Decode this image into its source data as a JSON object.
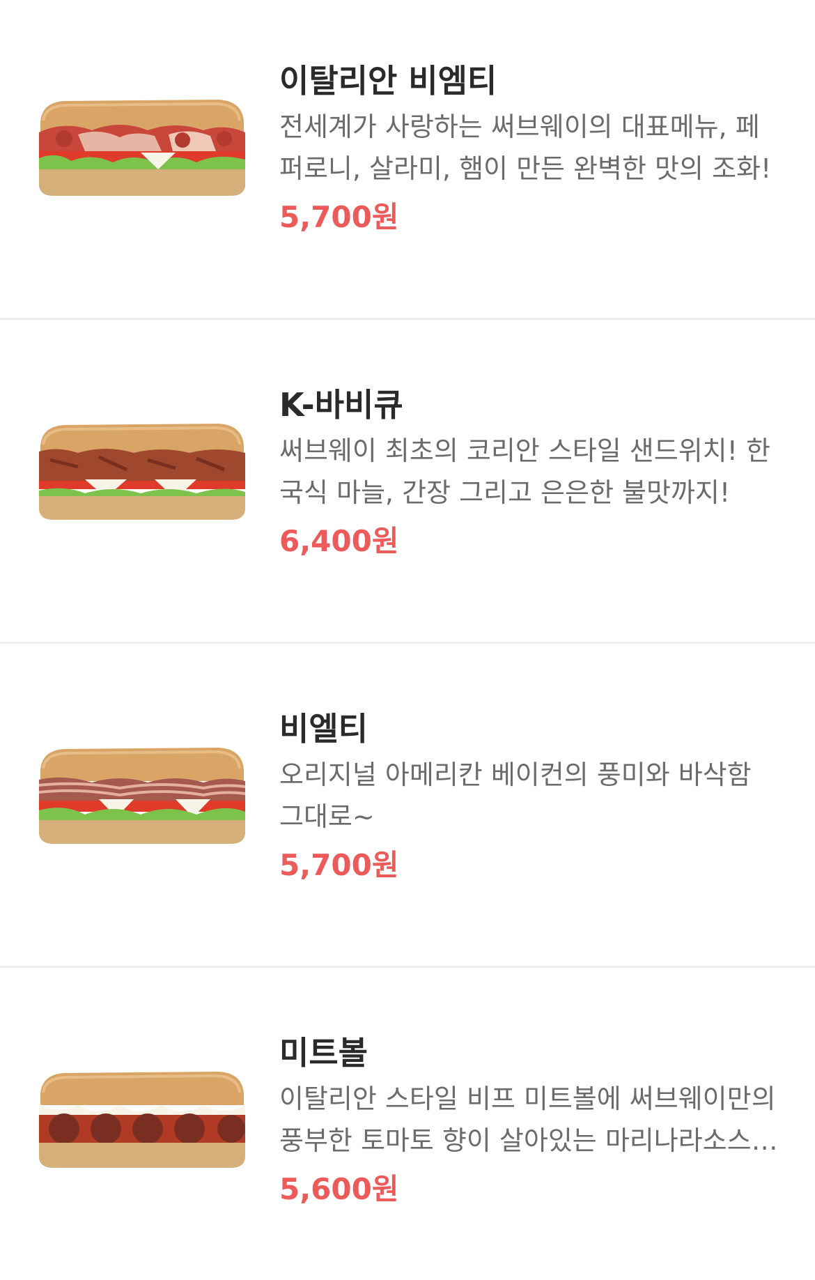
{
  "menu": {
    "items": [
      {
        "name": "이탈리안 비엠티",
        "description": "전세계가 사랑하는 써브웨이의 대표메뉴, 페퍼로니, 살라미, 햄이 만든 완벽한 맛의 조화!",
        "price": "5,700원",
        "image_icon": "italian-bmt-sandwich-image"
      },
      {
        "name": "K-바비큐",
        "description": "써브웨이 최초의 코리안 스타일 샌드위치! 한국식 마늘, 간장 그리고 은은한 불맛까지!",
        "price": "6,400원",
        "image_icon": "k-bbq-sandwich-image"
      },
      {
        "name": "비엘티",
        "description": "오리지널 아메리칸 베이컨의 풍미와 바삭함 그대로~",
        "price": "5,700원",
        "image_icon": "blt-sandwich-image"
      },
      {
        "name": "미트볼",
        "description": "이탈리안 스타일 비프 미트볼에 써브웨이만의 풍부한 토마토 향이 살아있는 마리나라소스…",
        "price": "5,600원",
        "image_icon": "meatball-sandwich-image"
      }
    ]
  },
  "colors": {
    "price": "#ec5a5a",
    "title": "#2a2a2a",
    "description": "#6b6b6b",
    "divider": "#ececec",
    "bread": "#d9a566",
    "bread_dark": "#c88a4a",
    "lettuce": "#7dc24a",
    "tomato": "#e03a2a",
    "cheese": "#f8f4e8",
    "meat_red": "#c9463a",
    "meat_pink": "#e8b4a4",
    "bbq": "#a0482e",
    "bacon": "#a65a4e",
    "meatball": "#7a2e22",
    "sauce": "#b03a24"
  }
}
